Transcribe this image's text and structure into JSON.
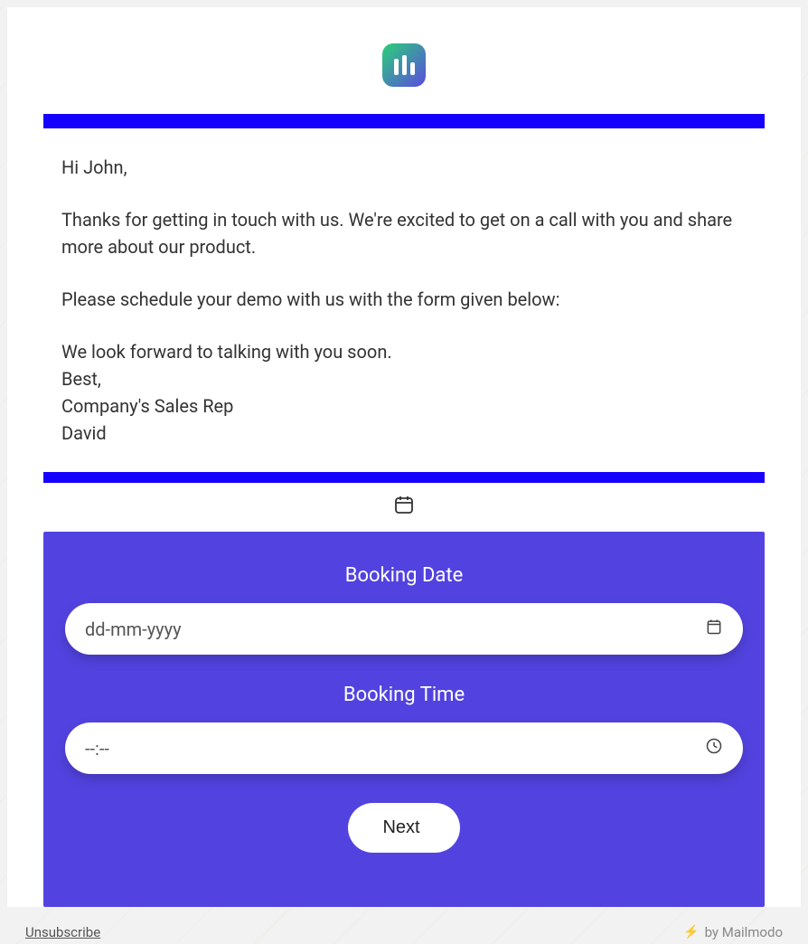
{
  "email": {
    "greeting": "Hi John,",
    "paragraph1": "Thanks for getting in touch with us. We're excited to get on a call with you and share more about our product.",
    "paragraph2": "Please schedule your demo with us with the form given below:",
    "paragraph3": "We look forward to talking with you soon.",
    "closing": "Best,",
    "signature1": "Company's Sales Rep",
    "signature2": "David"
  },
  "form": {
    "date_label": "Booking Date",
    "date_placeholder": "dd-mm-yyyy",
    "time_label": "Booking Time",
    "time_placeholder": "--:--",
    "next_button": "Next"
  },
  "footer": {
    "unsubscribe": "Unsubscribe",
    "branding": "by Mailmodo"
  }
}
